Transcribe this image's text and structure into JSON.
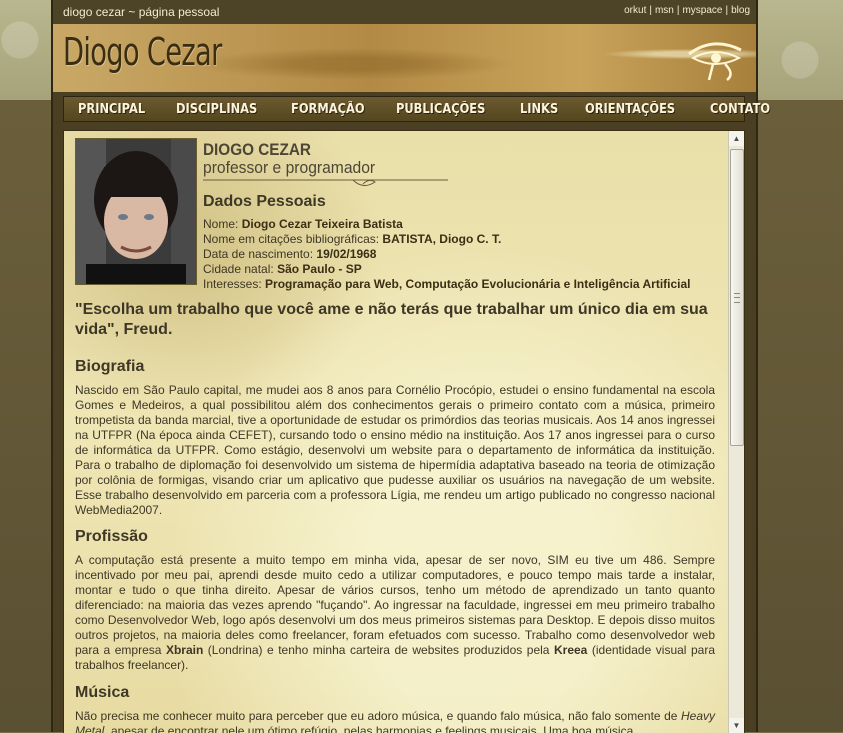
{
  "site": {
    "caption": "diogo cezar ~ página pessoal",
    "logo": "Diogo Cezar",
    "top_links": [
      "orkut",
      "msn",
      "myspace",
      "blog"
    ]
  },
  "nav": [
    "PRINCIPAL",
    "DISCIPLINAS",
    "FORMAÇÃO",
    "PUBLICAÇÕES",
    "LINKS",
    "ORIENTAÇÕES",
    "CONTATO"
  ],
  "profile": {
    "name": "DIOGO CEZAR",
    "subtitle": "professor e programador"
  },
  "dados": {
    "heading": "Dados Pessoais",
    "items": [
      {
        "label": "Nome:",
        "value": "Diogo Cezar Teixeira Batista"
      },
      {
        "label": "Nome em citações bibliográficas:",
        "value": "BATISTA, Diogo C. T."
      },
      {
        "label": "Data de nascimento:",
        "value": "19/02/1968"
      },
      {
        "label": "Cidade natal:",
        "value": "São Paulo - SP"
      },
      {
        "label": "Interesses:",
        "value": "Programação para Web, Computação Evolucionária e Inteligência Artificial"
      }
    ]
  },
  "quote": "\"Escolha um trabalho que você ame e não terás que trabalhar um único dia em sua vida\", Freud.",
  "biografia": {
    "heading": "Biografia",
    "text": "Nascido em São Paulo capital, me mudei aos 8 anos para Cornélio Procópio, estudei o ensino fundamental na escola Gomes e Medeiros, a qual possibilitou além dos conhecimentos gerais o primeiro contato com a música, primeiro trompetista da banda marcial, tive a oportunidade de estudar os primórdios das teorias musicais. Aos 14 anos ingressei na UTFPR (Na época ainda CEFET), cursando todo o ensino médio na instituição. Aos 17 anos ingressei para o curso de informática da UTFPR. Como estágio, desenvolvi um website para o departamento de informática da instituição. Para o trabalho de diplomação foi desenvolvido um sistema de hipermídia adaptativa baseado na teoria de otimização por colônia de formigas, visando criar um aplicativo que pudesse auxiliar os usuários na navegação de um website. Esse trabalho desenvolvido em parceria com a professora Lígia, me rendeu um artigo publicado no congresso nacional WebMedia2007."
  },
  "profissao": {
    "heading": "Profissão",
    "text_1": "A computação está presente a muito tempo em minha vida, apesar de ser novo, SIM eu tive um 486. Sempre incentivado por meu pai, aprendi desde muito cedo a utilizar computadores, e pouco tempo mais tarde a instalar, montar e tudo o que tinha direito. Apesar de vários cursos, tenho um método de aprendizado un tanto quanto diferenciado: na maioria das vezes aprendo \"fuçando\". Ao ingressar na faculdade, ingressei em meu primeiro trabalho como Desenvolvedor Web, logo após desenvolvi um dos meus primeiros sistemas para Desktop. E depois disso muitos outros projetos, na maioria deles como freelancer, foram efetuados com sucesso. Trabalho como desenvolvedor web para a empresa ",
    "company_1": "Xbrain",
    "text_2": " (Londrina) e tenho minha carteira de websites produzidos pela ",
    "company_2": "Krеea",
    "text_3": " (identidade visual para trabalhos freelancer)."
  },
  "musica": {
    "heading": "Música",
    "text_1": "Não precisa me conhecer muito para perceber que eu adoro música, e quando falo música, não falo somente de ",
    "genre": "Heavy Metal",
    "text_2": ", apesar de encontrar nele um ótimo refúgio, pelas harmonias e feelings musicais. Uma boa música"
  },
  "colors": {
    "accent": "#4a3f22",
    "paper": "#efe6b5",
    "text": "#3e3726"
  }
}
